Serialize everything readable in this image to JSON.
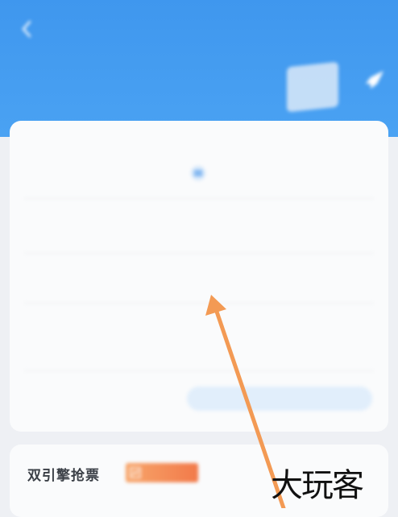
{
  "header": {
    "title": "",
    "right_action": "",
    "banner_title": "",
    "banner_subtitle": "",
    "color": "#3f97ee"
  },
  "form": {
    "from_hint": "",
    "to_hint": "",
    "from_city": "",
    "to_city": "",
    "rows": [
      {
        "label": "",
        "value": "",
        "action": ""
      },
      {
        "label": "",
        "value": "",
        "action": ""
      },
      {
        "label": "",
        "value": "",
        "action": ""
      }
    ],
    "contact_label": "",
    "contact_button": "",
    "accent": "#3c8ee8"
  },
  "engine": {
    "label": "双引擎抢票",
    "badge": "",
    "badge_color": "#f27a4a"
  },
  "annotation": {
    "arrow_color": "#f39a54",
    "watermark": "大玩客"
  },
  "icons": [
    "back-icon",
    "rocket-icon",
    "swap-icon",
    "chart-icon"
  ]
}
